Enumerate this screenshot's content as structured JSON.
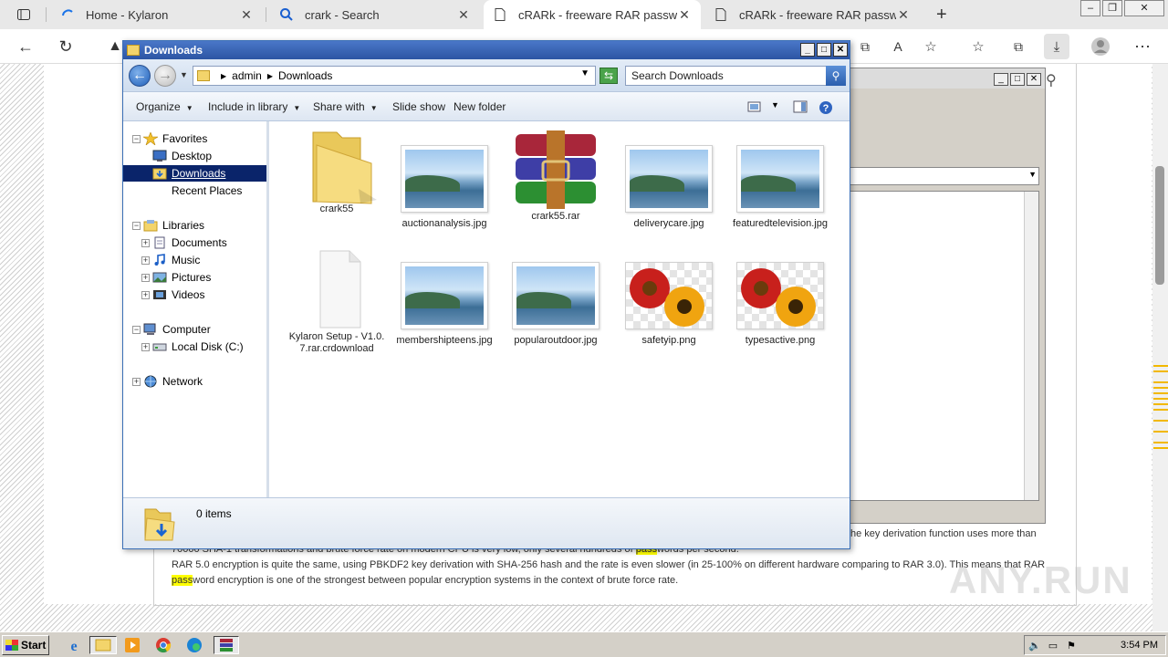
{
  "browser": {
    "tabs": [
      {
        "title": "Home - Kylaron"
      },
      {
        "title": "crark - Search"
      },
      {
        "title": "cRARk - freeware RAR password"
      },
      {
        "title": "cRARk - freeware RAR password"
      }
    ],
    "new_tab_label": "+"
  },
  "page": {
    "line1_a": "70000 SHA-1 transformations and brute force rate on modern CPU is very low, only several hundreds of ",
    "line1_hl": "pass",
    "line1_b": "words per second.",
    "line2": "RAR 5.0 encryption is quite the same, using PBKDF2 key derivation with SHA-256 hash and the rate is even slower (in 25-100% on different hardware comparing to RAR 3.0). This means that RAR",
    "line3_hl": "pass",
    "line3_b": "word encryption is one of the strongest between popular encryption systems in the context of brute force rate.",
    "right_fragment": "he key derivation function uses more than",
    "watermark": "ANY.RUN"
  },
  "explorer": {
    "title": "Downloads",
    "address": {
      "root": "admin",
      "folder": "Downloads"
    },
    "search_placeholder": "Search Downloads",
    "toolbar": {
      "organize": "Organize",
      "include_in_library": "Include in library",
      "share_with": "Share with",
      "slide_show": "Slide show",
      "new_folder": "New folder"
    },
    "nav": {
      "favorites": "Favorites",
      "desktop": "Desktop",
      "downloads": "Downloads",
      "recent_places": "Recent Places",
      "libraries": "Libraries",
      "documents": "Documents",
      "music": "Music",
      "pictures": "Pictures",
      "videos": "Videos",
      "computer": "Computer",
      "local_disk": "Local Disk (C:)",
      "network": "Network"
    },
    "files": [
      {
        "name": "crark55",
        "kind": "folder"
      },
      {
        "name": "auctionanalysis.jpg",
        "kind": "landscape"
      },
      {
        "name": "crark55.rar",
        "kind": "winrar"
      },
      {
        "name": "deliverycare.jpg",
        "kind": "landscape"
      },
      {
        "name": "featuredtelevision.jpg",
        "kind": "landscape"
      },
      {
        "name": "Kylaron Setup - V1.0.7.rar.crdownload",
        "kind": "blank"
      },
      {
        "name": "membershipteens.jpg",
        "kind": "landscape"
      },
      {
        "name": "popularoutdoor.jpg",
        "kind": "landscape"
      },
      {
        "name": "safetyip.png",
        "kind": "flowers"
      },
      {
        "name": "typesactive.png",
        "kind": "flowers"
      }
    ],
    "status": {
      "count": "0 items"
    }
  },
  "taskbar": {
    "start": "Start",
    "clock": "3:54 PM"
  },
  "colors": {
    "explorer_title": "#2c55a3",
    "selection": "#0a246a",
    "highlight": "#ffff00"
  }
}
